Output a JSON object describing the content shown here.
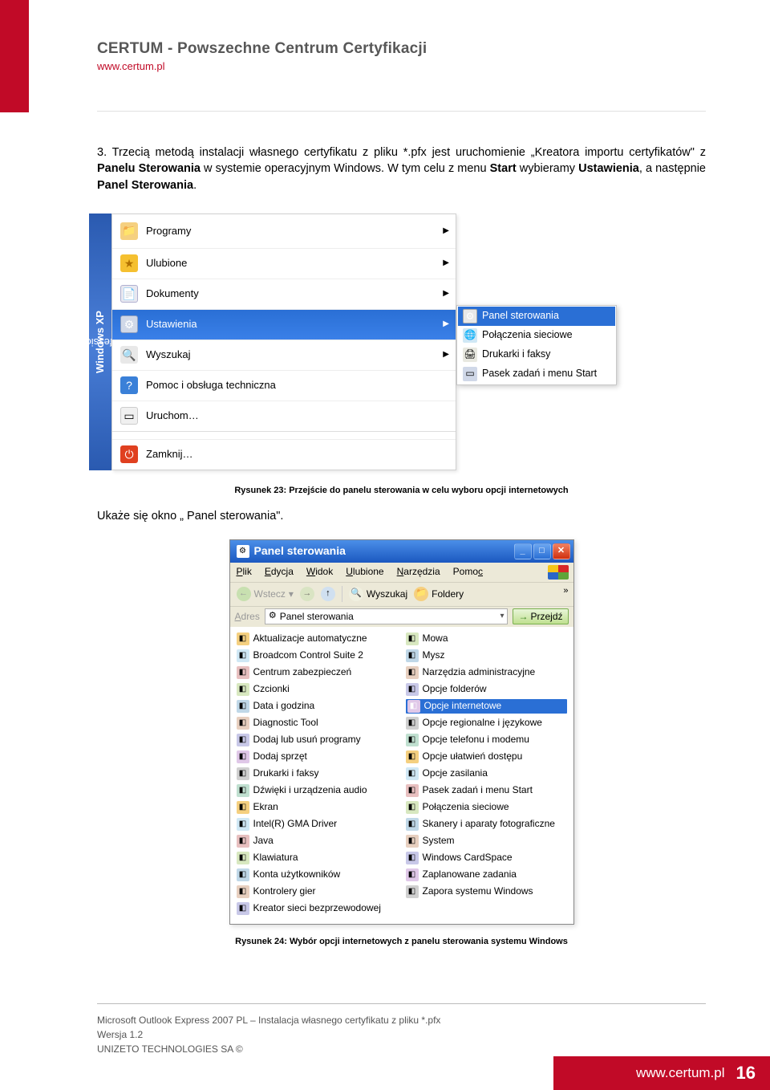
{
  "header": {
    "title": "CERTUM - Powszechne Centrum Certyfikacji",
    "url": "www.certum.pl"
  },
  "para1_parts": {
    "a": "3. Trzecią metodą instalacji własnego certyfikatu z pliku *.pfx jest uruchomienie „Kreatora importu certyfikatów\" z ",
    "b": "Panelu Sterowania",
    "c": " w systemie operacyjnym Windows. W tym celu z menu ",
    "d": "Start",
    "e": " wybieramy ",
    "f": "Ustawienia",
    "g": ", a następnie ",
    "h": "Panel Sterowania",
    "i": "."
  },
  "start_menu": {
    "os_label": "Windows XP",
    "os_edition": "Professional",
    "items": [
      {
        "label": "Programy",
        "arrow": true
      },
      {
        "label": "Ulubione",
        "arrow": true
      },
      {
        "label": "Dokumenty",
        "arrow": true
      },
      {
        "label": "Ustawienia",
        "arrow": true,
        "highlight": true
      },
      {
        "label": "Wyszukaj",
        "arrow": true
      },
      {
        "label": "Pomoc i obsługa techniczna",
        "arrow": false
      },
      {
        "label": "Uruchom…",
        "arrow": false
      },
      {
        "label": "Zamknij…",
        "arrow": false
      }
    ],
    "submenu": [
      {
        "label": "Panel sterowania",
        "highlight": true
      },
      {
        "label": "Połączenia sieciowe"
      },
      {
        "label": "Drukarki i faksy"
      },
      {
        "label": "Pasek zadań i menu Start"
      }
    ]
  },
  "caption1": "Rysunek 23: Przejście do panelu sterowania w celu wyboru opcji internetowych",
  "para2": "Ukaże się okno „ Panel sterowania\".",
  "cp": {
    "title": "Panel sterowania",
    "menus": [
      "Plik",
      "Edycja",
      "Widok",
      "Ulubione",
      "Narzędzia",
      "Pomoc"
    ],
    "toolbar": {
      "back": "Wstecz",
      "search": "Wyszukaj",
      "folders": "Foldery"
    },
    "address_label": "Adres",
    "address_value": "Panel sterowania",
    "go": "Przejdź",
    "left": [
      "Aktualizacje automatyczne",
      "Broadcom Control Suite 2",
      "Centrum zabezpieczeń",
      "Czcionki",
      "Data i godzina",
      "Diagnostic Tool",
      "Dodaj lub usuń programy",
      "Dodaj sprzęt",
      "Drukarki i faksy",
      "Dźwięki i urządzenia audio",
      "Ekran",
      "Intel(R) GMA Driver",
      "Java",
      "Klawiatura",
      "Konta użytkowników",
      "Kontrolery gier",
      "Kreator sieci bezprzewodowej"
    ],
    "right": [
      {
        "label": "Mowa"
      },
      {
        "label": "Mysz"
      },
      {
        "label": "Narzędzia administracyjne"
      },
      {
        "label": "Opcje folderów"
      },
      {
        "label": "Opcje internetowe",
        "sel": true
      },
      {
        "label": "Opcje regionalne i językowe"
      },
      {
        "label": "Opcje telefonu i modemu"
      },
      {
        "label": "Opcje ułatwień dostępu"
      },
      {
        "label": "Opcje zasilania"
      },
      {
        "label": "Pasek zadań i menu Start"
      },
      {
        "label": "Połączenia sieciowe"
      },
      {
        "label": "Skanery i aparaty fotograficzne"
      },
      {
        "label": "System"
      },
      {
        "label": "Windows CardSpace"
      },
      {
        "label": "Zaplanowane zadania"
      },
      {
        "label": "Zapora systemu Windows"
      }
    ]
  },
  "caption2": "Rysunek 24: Wybór opcji internetowych z panelu sterowania systemu Windows",
  "footer": {
    "line1": "Microsoft Outlook Express 2007 PL – Instalacja własnego certyfikatu  z pliku *.pfx",
    "line2": "Wersja 1.2",
    "line3": "UNIZETO TECHNOLOGIES SA ©"
  },
  "corner": {
    "url": "www.certum.pl",
    "page": "16"
  }
}
